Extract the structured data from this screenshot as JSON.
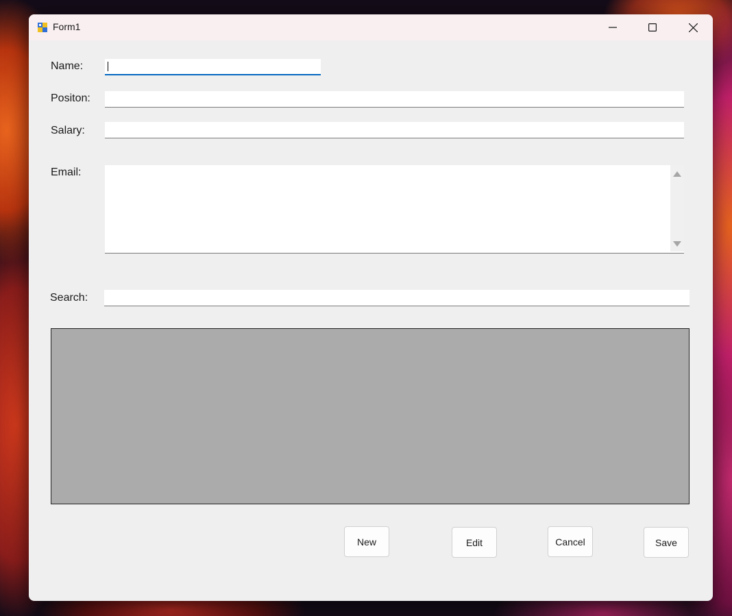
{
  "window": {
    "title": "Form1"
  },
  "fields": {
    "name_label": "Name:",
    "position_label": "Positon:",
    "salary_label": "Salary:",
    "email_label": "Email:",
    "search_label": "Search:"
  },
  "values": {
    "name": "",
    "position": "",
    "salary": "",
    "email": "",
    "search": ""
  },
  "buttons": {
    "new": "New",
    "edit": "Edit",
    "cancel": "Cancel",
    "save": "Save"
  },
  "icons": {
    "app": "winforms-app-icon",
    "minimize": "minimize-icon",
    "maximize": "maximize-icon",
    "close": "close-icon",
    "scroll_up": "scroll-up-arrow-icon",
    "scroll_down": "scroll-down-arrow-icon"
  },
  "colors": {
    "focus_accent": "#0067c0",
    "grid_background": "#ababab",
    "form_background": "#efefef"
  }
}
